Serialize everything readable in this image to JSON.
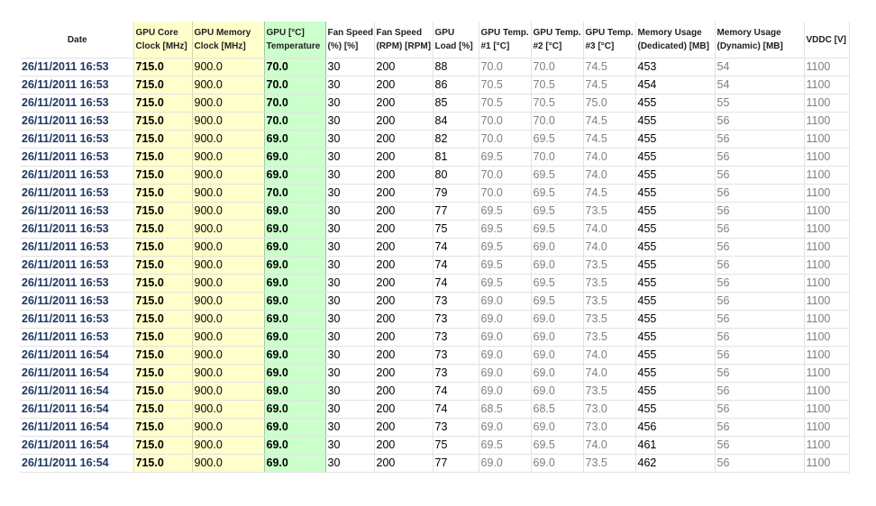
{
  "table": {
    "headers": {
      "date": "Date",
      "core": "GPU Core Clock [MHz]",
      "mem": "GPU Memory Clock [MHz]",
      "temp": "GPU [°C] Temperature",
      "fan": "Fan Speed (%) [%]",
      "rpm": "Fan Speed (RPM) [RPM]",
      "load": "GPU Load [%]",
      "t1": "GPU Temp. #1 [°C]",
      "t2": "GPU Temp. #2 [°C]",
      "t3": "GPU Temp. #3 [°C]",
      "dedi": "Memory Usage (Dedicated) [MB]",
      "dyn": "Memory Usage (Dynamic) [MB]",
      "vddc": "VDDC [V]"
    },
    "rows": [
      {
        "date": "26/11/2011 16:53",
        "core": "715.0",
        "mem": "900.0",
        "temp": "70.0",
        "fan": "30",
        "rpm": "200",
        "load": "88",
        "t1": "70.0",
        "t2": "70.0",
        "t3": "74.5",
        "dedi": "453",
        "dyn": "54",
        "vddc": "1100"
      },
      {
        "date": "26/11/2011 16:53",
        "core": "715.0",
        "mem": "900.0",
        "temp": "70.0",
        "fan": "30",
        "rpm": "200",
        "load": "86",
        "t1": "70.5",
        "t2": "70.5",
        "t3": "74.5",
        "dedi": "454",
        "dyn": "54",
        "vddc": "1100"
      },
      {
        "date": "26/11/2011 16:53",
        "core": "715.0",
        "mem": "900.0",
        "temp": "70.0",
        "fan": "30",
        "rpm": "200",
        "load": "85",
        "t1": "70.5",
        "t2": "70.5",
        "t3": "75.0",
        "dedi": "455",
        "dyn": "55",
        "vddc": "1100"
      },
      {
        "date": "26/11/2011 16:53",
        "core": "715.0",
        "mem": "900.0",
        "temp": "70.0",
        "fan": "30",
        "rpm": "200",
        "load": "84",
        "t1": "70.0",
        "t2": "70.0",
        "t3": "74.5",
        "dedi": "455",
        "dyn": "56",
        "vddc": "1100"
      },
      {
        "date": "26/11/2011 16:53",
        "core": "715.0",
        "mem": "900.0",
        "temp": "69.0",
        "fan": "30",
        "rpm": "200",
        "load": "82",
        "t1": "70.0",
        "t2": "69.5",
        "t3": "74.5",
        "dedi": "455",
        "dyn": "56",
        "vddc": "1100"
      },
      {
        "date": "26/11/2011 16:53",
        "core": "715.0",
        "mem": "900.0",
        "temp": "69.0",
        "fan": "30",
        "rpm": "200",
        "load": "81",
        "t1": "69.5",
        "t2": "70.0",
        "t3": "74.0",
        "dedi": "455",
        "dyn": "56",
        "vddc": "1100"
      },
      {
        "date": "26/11/2011 16:53",
        "core": "715.0",
        "mem": "900.0",
        "temp": "69.0",
        "fan": "30",
        "rpm": "200",
        "load": "80",
        "t1": "70.0",
        "t2": "69.5",
        "t3": "74.0",
        "dedi": "455",
        "dyn": "56",
        "vddc": "1100"
      },
      {
        "date": "26/11/2011 16:53",
        "core": "715.0",
        "mem": "900.0",
        "temp": "70.0",
        "fan": "30",
        "rpm": "200",
        "load": "79",
        "t1": "70.0",
        "t2": "69.5",
        "t3": "74.5",
        "dedi": "455",
        "dyn": "56",
        "vddc": "1100"
      },
      {
        "date": "26/11/2011 16:53",
        "core": "715.0",
        "mem": "900.0",
        "temp": "69.0",
        "fan": "30",
        "rpm": "200",
        "load": "77",
        "t1": "69.5",
        "t2": "69.5",
        "t3": "73.5",
        "dedi": "455",
        "dyn": "56",
        "vddc": "1100"
      },
      {
        "date": "26/11/2011 16:53",
        "core": "715.0",
        "mem": "900.0",
        "temp": "69.0",
        "fan": "30",
        "rpm": "200",
        "load": "75",
        "t1": "69.5",
        "t2": "69.5",
        "t3": "74.0",
        "dedi": "455",
        "dyn": "56",
        "vddc": "1100"
      },
      {
        "date": "26/11/2011 16:53",
        "core": "715.0",
        "mem": "900.0",
        "temp": "69.0",
        "fan": "30",
        "rpm": "200",
        "load": "74",
        "t1": "69.5",
        "t2": "69.0",
        "t3": "74.0",
        "dedi": "455",
        "dyn": "56",
        "vddc": "1100"
      },
      {
        "date": "26/11/2011 16:53",
        "core": "715.0",
        "mem": "900.0",
        "temp": "69.0",
        "fan": "30",
        "rpm": "200",
        "load": "74",
        "t1": "69.5",
        "t2": "69.0",
        "t3": "73.5",
        "dedi": "455",
        "dyn": "56",
        "vddc": "1100"
      },
      {
        "date": "26/11/2011 16:53",
        "core": "715.0",
        "mem": "900.0",
        "temp": "69.0",
        "fan": "30",
        "rpm": "200",
        "load": "74",
        "t1": "69.5",
        "t2": "69.5",
        "t3": "73.5",
        "dedi": "455",
        "dyn": "56",
        "vddc": "1100"
      },
      {
        "date": "26/11/2011 16:53",
        "core": "715.0",
        "mem": "900.0",
        "temp": "69.0",
        "fan": "30",
        "rpm": "200",
        "load": "73",
        "t1": "69.0",
        "t2": "69.5",
        "t3": "73.5",
        "dedi": "455",
        "dyn": "56",
        "vddc": "1100"
      },
      {
        "date": "26/11/2011 16:53",
        "core": "715.0",
        "mem": "900.0",
        "temp": "69.0",
        "fan": "30",
        "rpm": "200",
        "load": "73",
        "t1": "69.0",
        "t2": "69.0",
        "t3": "73.5",
        "dedi": "455",
        "dyn": "56",
        "vddc": "1100"
      },
      {
        "date": "26/11/2011 16:53",
        "core": "715.0",
        "mem": "900.0",
        "temp": "69.0",
        "fan": "30",
        "rpm": "200",
        "load": "73",
        "t1": "69.0",
        "t2": "69.0",
        "t3": "73.5",
        "dedi": "455",
        "dyn": "56",
        "vddc": "1100"
      },
      {
        "date": "26/11/2011 16:54",
        "core": "715.0",
        "mem": "900.0",
        "temp": "69.0",
        "fan": "30",
        "rpm": "200",
        "load": "73",
        "t1": "69.0",
        "t2": "69.0",
        "t3": "74.0",
        "dedi": "455",
        "dyn": "56",
        "vddc": "1100"
      },
      {
        "date": "26/11/2011 16:54",
        "core": "715.0",
        "mem": "900.0",
        "temp": "69.0",
        "fan": "30",
        "rpm": "200",
        "load": "73",
        "t1": "69.0",
        "t2": "69.0",
        "t3": "74.0",
        "dedi": "455",
        "dyn": "56",
        "vddc": "1100"
      },
      {
        "date": "26/11/2011 16:54",
        "core": "715.0",
        "mem": "900.0",
        "temp": "69.0",
        "fan": "30",
        "rpm": "200",
        "load": "74",
        "t1": "69.0",
        "t2": "69.0",
        "t3": "73.5",
        "dedi": "455",
        "dyn": "56",
        "vddc": "1100"
      },
      {
        "date": "26/11/2011 16:54",
        "core": "715.0",
        "mem": "900.0",
        "temp": "69.0",
        "fan": "30",
        "rpm": "200",
        "load": "74",
        "t1": "68.5",
        "t2": "68.5",
        "t3": "73.0",
        "dedi": "455",
        "dyn": "56",
        "vddc": "1100"
      },
      {
        "date": "26/11/2011 16:54",
        "core": "715.0",
        "mem": "900.0",
        "temp": "69.0",
        "fan": "30",
        "rpm": "200",
        "load": "73",
        "t1": "69.0",
        "t2": "69.0",
        "t3": "73.0",
        "dedi": "456",
        "dyn": "56",
        "vddc": "1100"
      },
      {
        "date": "26/11/2011 16:54",
        "core": "715.0",
        "mem": "900.0",
        "temp": "69.0",
        "fan": "30",
        "rpm": "200",
        "load": "75",
        "t1": "69.5",
        "t2": "69.5",
        "t3": "74.0",
        "dedi": "461",
        "dyn": "56",
        "vddc": "1100"
      },
      {
        "date": "26/11/2011 16:54",
        "core": "715.0",
        "mem": "900.0",
        "temp": "69.0",
        "fan": "30",
        "rpm": "200",
        "load": "77",
        "t1": "69.0",
        "t2": "69.0",
        "t3": "73.5",
        "dedi": "462",
        "dyn": "56",
        "vddc": "1100"
      }
    ]
  }
}
